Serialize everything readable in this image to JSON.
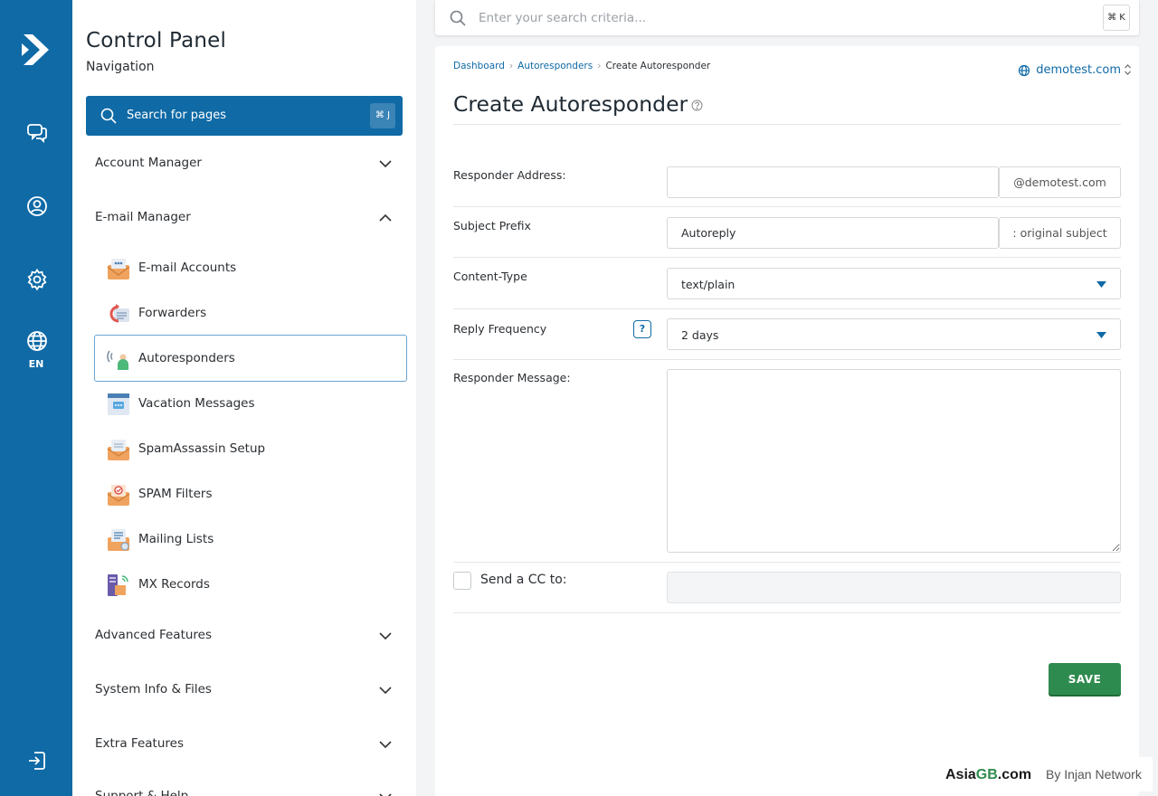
{
  "rail": {
    "language": "EN"
  },
  "sidebar": {
    "title": "Control Panel",
    "subtitle": "Navigation",
    "search_label": "Search for pages",
    "search_shortcut": "⌘ J",
    "sections": [
      {
        "label": "Account Manager",
        "expanded": false
      },
      {
        "label": "E-mail Manager",
        "expanded": true
      },
      {
        "label": "Advanced Features",
        "expanded": false
      },
      {
        "label": "System Info & Files",
        "expanded": false
      },
      {
        "label": "Extra Features",
        "expanded": false
      },
      {
        "label": "Support & Help",
        "expanded": false
      }
    ],
    "email_items": [
      {
        "label": "E-mail Accounts",
        "icon": "email-accounts-icon"
      },
      {
        "label": "Forwarders",
        "icon": "forwarders-icon"
      },
      {
        "label": "Autoresponders",
        "icon": "autoresponders-icon",
        "active": true
      },
      {
        "label": "Vacation Messages",
        "icon": "vacation-messages-icon"
      },
      {
        "label": "SpamAssassin Setup",
        "icon": "spamassassin-icon"
      },
      {
        "label": "SPAM Filters",
        "icon": "spam-filters-icon"
      },
      {
        "label": "Mailing Lists",
        "icon": "mailing-lists-icon"
      },
      {
        "label": "MX Records",
        "icon": "mx-records-icon"
      }
    ]
  },
  "topsearch": {
    "placeholder": "Enter your search criteria...",
    "shortcut": "⌘ K"
  },
  "main": {
    "breadcrumb": [
      "Dashboard",
      "Autoresponders",
      "Create Autoresponder"
    ],
    "domain": "demotest.com",
    "title": "Create Autoresponder",
    "form": {
      "responder_address_label": "Responder Address:",
      "responder_address_value": "",
      "responder_address_suffix": "@demotest.com",
      "subject_prefix_label": "Subject Prefix",
      "subject_prefix_value": "Autoreply",
      "subject_prefix_suffix": ": original subject",
      "content_type_label": "Content-Type",
      "content_type_value": "text/plain",
      "reply_frequency_label": "Reply Frequency",
      "reply_frequency_help": "?",
      "reply_frequency_value": "2 days",
      "message_label": "Responder Message:",
      "message_value": "",
      "cc_label": "Send a CC to:",
      "cc_checked": false,
      "save_label": "SAVE"
    }
  },
  "footer_brand": {
    "name_prefix": "Asia",
    "name_highlight": "GB",
    "name_suffix": ".com",
    "byline": "By Injan Network"
  },
  "colors": {
    "primary": "#0f6aa6",
    "save": "#2e8b4f",
    "background": "#f3f4f6"
  }
}
